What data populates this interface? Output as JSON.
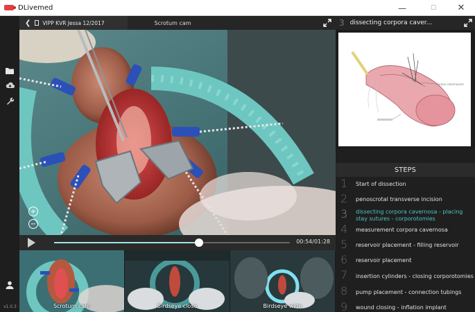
{
  "window": {
    "title": "DLivemed",
    "minimize": "—",
    "maximize": "☐",
    "close": "✕"
  },
  "sidebar": {
    "items": [
      {
        "icon": "folder-icon"
      },
      {
        "icon": "cloud-download-icon"
      },
      {
        "icon": "wrench-icon"
      }
    ],
    "user_icon": "user-icon",
    "version": "v1.0.3"
  },
  "header": {
    "breadcrumb": "VIPP KVR Jessa 12/2017",
    "camera_name": "Scrotum cam"
  },
  "player": {
    "current_time": "00:54",
    "duration": "01:28",
    "time_display": "00:54/01:28",
    "progress": 0.614
  },
  "thumbnails": [
    {
      "label": "Scrotum cam"
    },
    {
      "label": "Birdseye close"
    },
    {
      "label": "Birdseye wide"
    }
  ],
  "current_step": {
    "number": "3",
    "title": "dissecting corpora caver..."
  },
  "steps_header": "STEPS",
  "steps": [
    {
      "number": "1",
      "label": "Start of dissection"
    },
    {
      "number": "2",
      "label": "penoscrotal transverse incision"
    },
    {
      "number": "3",
      "label": "dissecting corpora cavernosa - placing stay sutures - corporotomies",
      "active": true
    },
    {
      "number": "4",
      "label": "measurement corpora cavernosa"
    },
    {
      "number": "5",
      "label": "reservoir placement - filling reservoir"
    },
    {
      "number": "6",
      "label": "reservoir placement"
    },
    {
      "number": "7",
      "label": "insertion cylinders - closing corporotomies"
    },
    {
      "number": "8",
      "label": "pump placement - connection tubings"
    },
    {
      "number": "9",
      "label": "wound closing - inflation implant"
    }
  ],
  "colors": {
    "accent": "#4fc4c4",
    "background": "#1c1c1c"
  }
}
